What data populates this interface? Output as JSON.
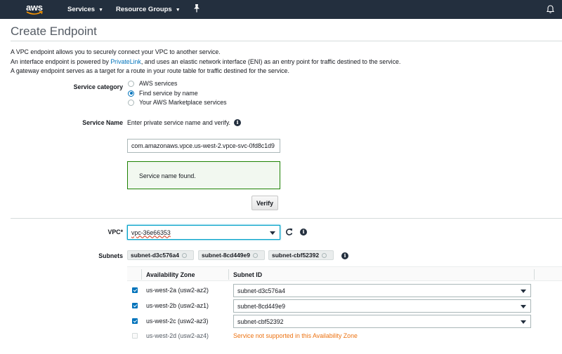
{
  "nav": {
    "logo": "aws",
    "services": "Services",
    "resource_groups": "Resource Groups"
  },
  "page_title": "Create Endpoint",
  "intro": {
    "line1": "A VPC endpoint allows you to securely connect your VPC to another service.",
    "line2_pre": "An interface endpoint is powered by ",
    "line2_link": "PrivateLink",
    "line2_post": ", and uses an elastic network interface (ENI) as an entry point for traffic destined to the service.",
    "line3": "A gateway endpoint serves as a target for a route in your route table for traffic destined for the service."
  },
  "service_category": {
    "label": "Service category",
    "options": [
      "AWS services",
      "Find service by name",
      "Your AWS Marketplace services"
    ],
    "selected": "Find service by name"
  },
  "service_name": {
    "label": "Service Name",
    "hint": "Enter private service name and verify.",
    "value": "com.amazonaws.vpce.us-west-2.vpce-svc-0fd8c1d9",
    "status": "Service name found.",
    "verify_label": "Verify"
  },
  "vpc": {
    "label": "VPC*",
    "value": "vpc-36e66353"
  },
  "subnets": {
    "label": "Subnets",
    "tokens": [
      "subnet-d3c576a4",
      "subnet-8cd449e9",
      "subnet-cbf52392"
    ],
    "columns": [
      "Availability Zone",
      "Subnet ID"
    ],
    "rows": [
      {
        "az": "us-west-2a (usw2-az2)",
        "subnet": "subnet-d3c576a4",
        "checked": true
      },
      {
        "az": "us-west-2b (usw2-az1)",
        "subnet": "subnet-8cd449e9",
        "checked": true
      },
      {
        "az": "us-west-2c (usw2-az3)",
        "subnet": "subnet-cbf52392",
        "checked": true
      },
      {
        "az": "us-west-2d (usw2-az4)",
        "subnet": "Service not supported in this Availability Zone",
        "checked": false
      }
    ]
  },
  "colors": {
    "nav_bg": "#232f3e",
    "link": "#0073bb",
    "success_border": "#1d8102",
    "warning": "#ec7211"
  }
}
